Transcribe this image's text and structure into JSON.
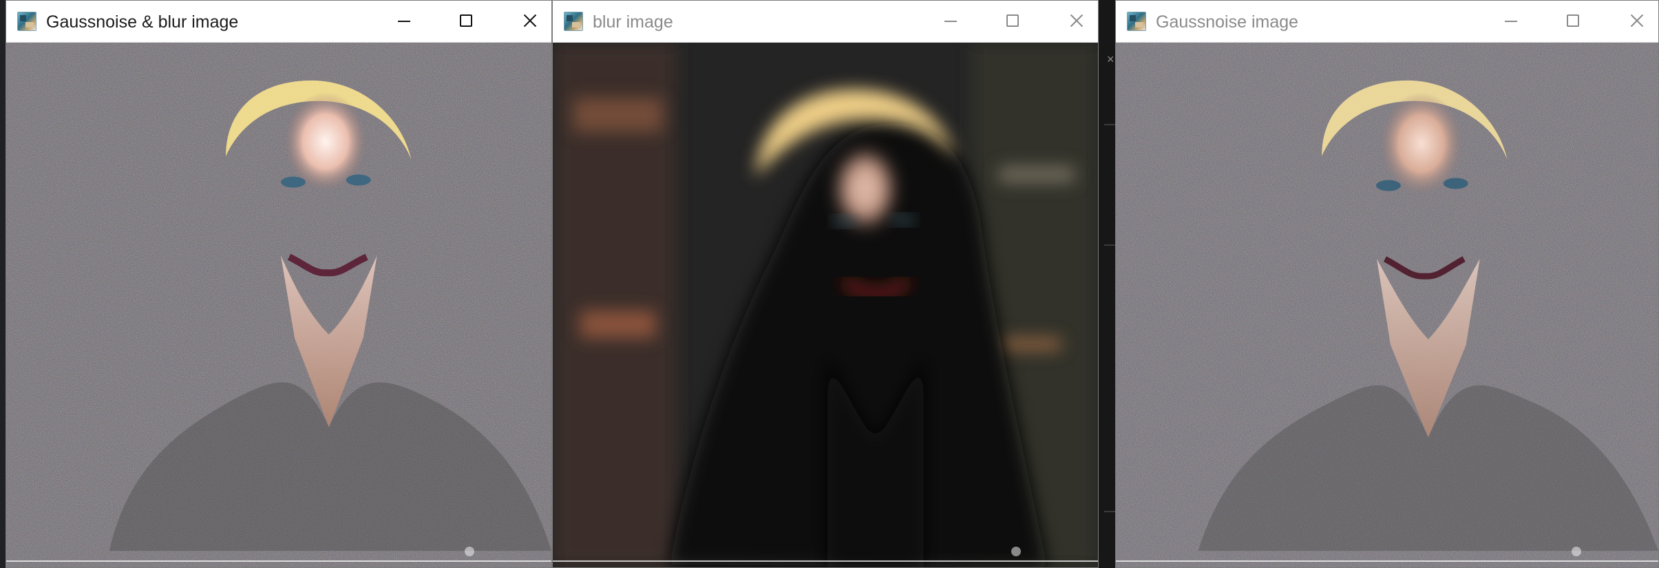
{
  "windows": [
    {
      "title": "Gaussnoise & blur image",
      "state": "active",
      "image_semantic": "noisy-portrait"
    },
    {
      "title": "blur image",
      "state": "inactive",
      "image_semantic": "blurred-portrait"
    },
    {
      "title": "Gaussnoise image",
      "state": "inactive",
      "image_semantic": "noisy-portrait"
    }
  ],
  "icons": {
    "app": "image-window-icon",
    "minimize": "minimize-icon",
    "maximize": "maximize-icon",
    "close": "close-icon"
  },
  "colors": {
    "active_title": "#1b1b1b",
    "inactive_title": "#8a8a8a",
    "titlebar": "#ffffff",
    "border": "#7b7b7b"
  }
}
